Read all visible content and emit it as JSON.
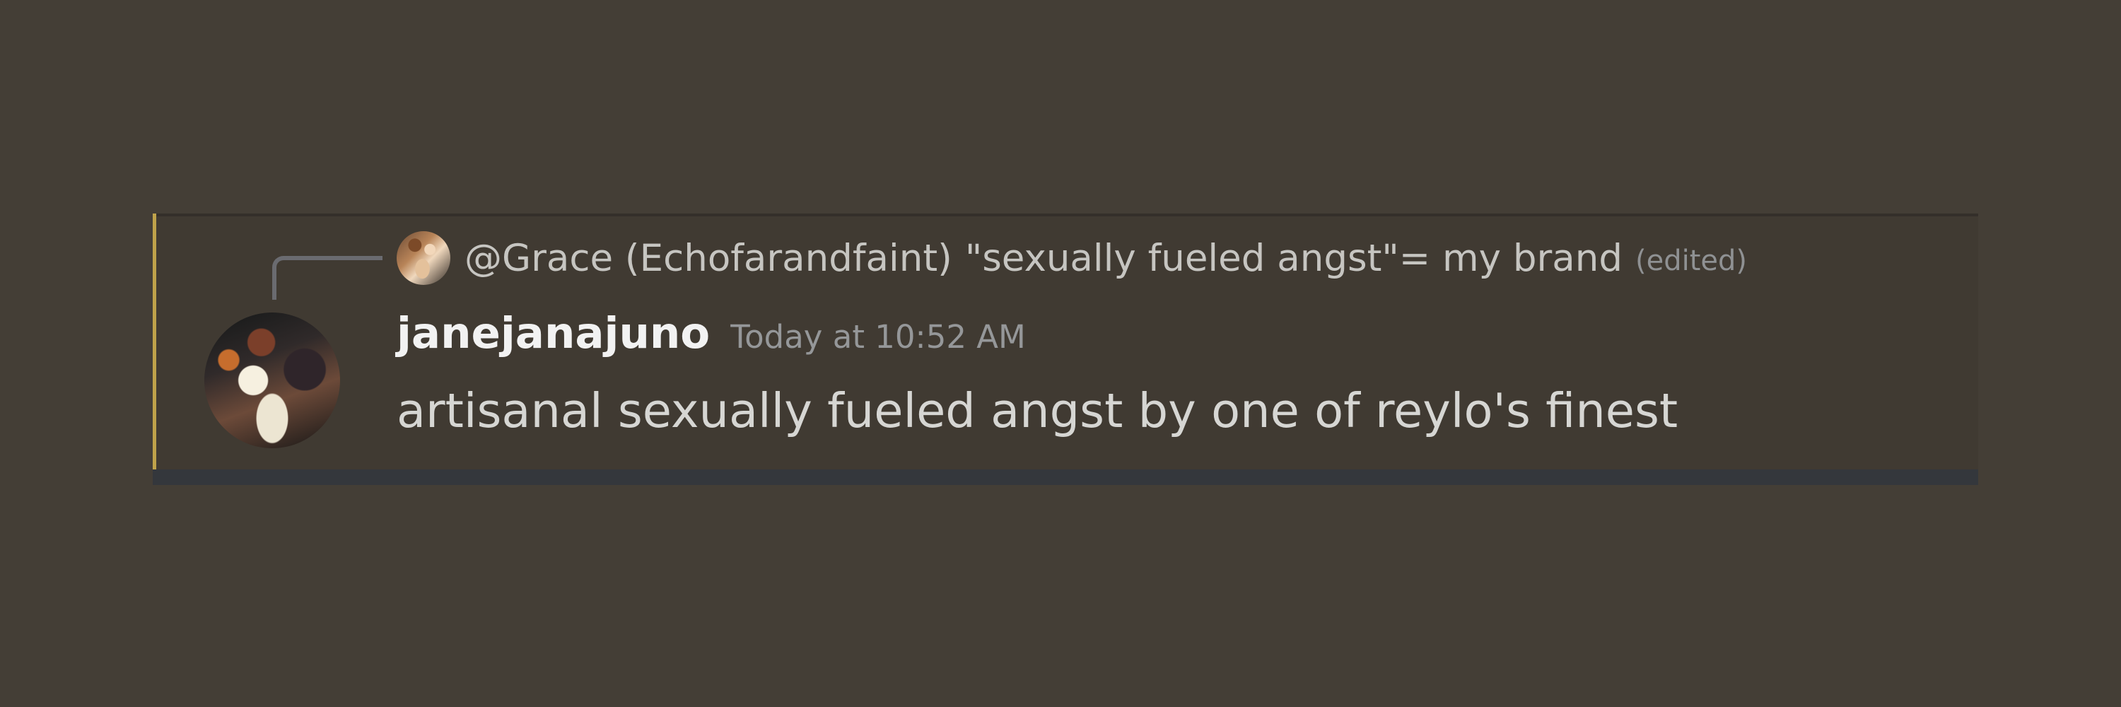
{
  "reply": {
    "author": "@Grace (Echofarandfaint)",
    "text": "\"sexually fueled angst\"= my brand",
    "edited_label": "(edited)"
  },
  "message": {
    "username": "janejanajuno",
    "timestamp": "Today at 10:52 AM",
    "content": "artisanal sexually fueled angst by one of reylo's finest"
  },
  "colors": {
    "background": "#443e36",
    "highlight_accent": "#bfa24a",
    "username": "#f2f2f2",
    "muted_text": "#959799"
  }
}
